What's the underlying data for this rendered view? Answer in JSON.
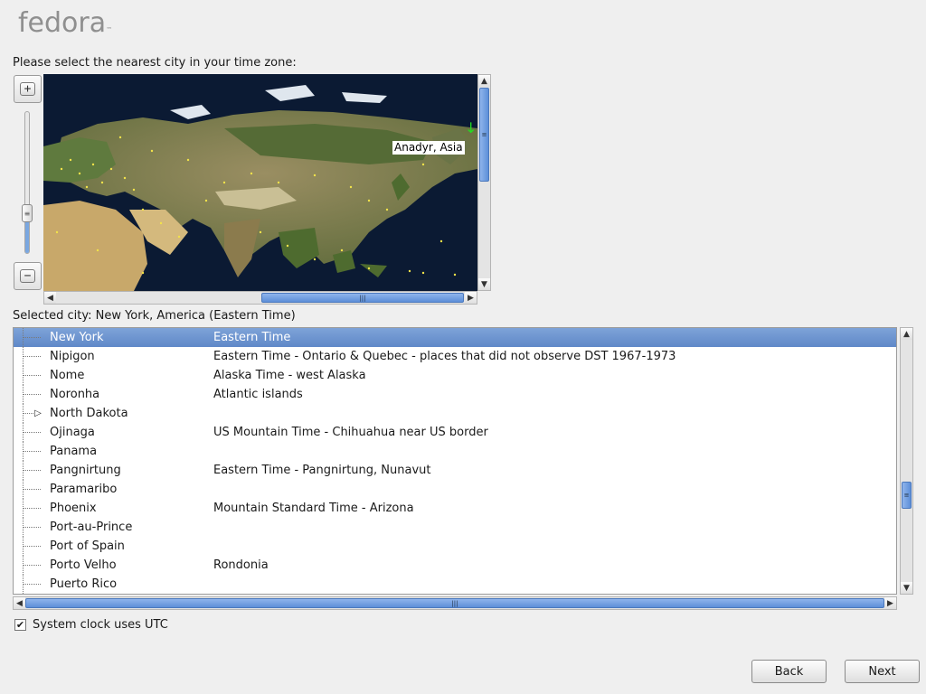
{
  "brand": {
    "name": "fedora",
    "mark": "™"
  },
  "prompt": "Please select the nearest city in your time zone:",
  "zoom": {
    "in_glyph": "+",
    "out_glyph": "−",
    "level_fraction": 0.27
  },
  "map": {
    "hover_label": "Anadyr, Asia",
    "pin_icon": "arrow-down",
    "colors": {
      "ocean": "#0b1a33",
      "land": "#8a8a5a",
      "city_dot": "#f2e34a"
    }
  },
  "selected_city_text": "Selected city: New York, America (Eastern Time)",
  "cities": [
    {
      "city": "New York",
      "zone": "Eastern Time",
      "selected": true,
      "expandable": false
    },
    {
      "city": "Nipigon",
      "zone": "Eastern Time - Ontario & Quebec - places that did not observe DST 1967-1973",
      "selected": false,
      "expandable": false
    },
    {
      "city": "Nome",
      "zone": "Alaska Time - west Alaska",
      "selected": false,
      "expandable": false
    },
    {
      "city": "Noronha",
      "zone": "Atlantic islands",
      "selected": false,
      "expandable": false
    },
    {
      "city": "North Dakota",
      "zone": "",
      "selected": false,
      "expandable": true
    },
    {
      "city": "Ojinaga",
      "zone": "US Mountain Time - Chihuahua near US border",
      "selected": false,
      "expandable": false
    },
    {
      "city": "Panama",
      "zone": "",
      "selected": false,
      "expandable": false
    },
    {
      "city": "Pangnirtung",
      "zone": "Eastern Time - Pangnirtung, Nunavut",
      "selected": false,
      "expandable": false
    },
    {
      "city": "Paramaribo",
      "zone": "",
      "selected": false,
      "expandable": false
    },
    {
      "city": "Phoenix",
      "zone": "Mountain Standard Time - Arizona",
      "selected": false,
      "expandable": false
    },
    {
      "city": "Port-au-Prince",
      "zone": "",
      "selected": false,
      "expandable": false
    },
    {
      "city": "Port of Spain",
      "zone": "",
      "selected": false,
      "expandable": false
    },
    {
      "city": "Porto Velho",
      "zone": "Rondonia",
      "selected": false,
      "expandable": false
    },
    {
      "city": "Puerto Rico",
      "zone": "",
      "selected": false,
      "expandable": false
    }
  ],
  "utc": {
    "label": "System clock uses UTC",
    "checked": true
  },
  "buttons": {
    "back": "Back",
    "next": "Next"
  },
  "colors": {
    "selection": "#6a92cf",
    "accent": "#5d8fd8"
  }
}
